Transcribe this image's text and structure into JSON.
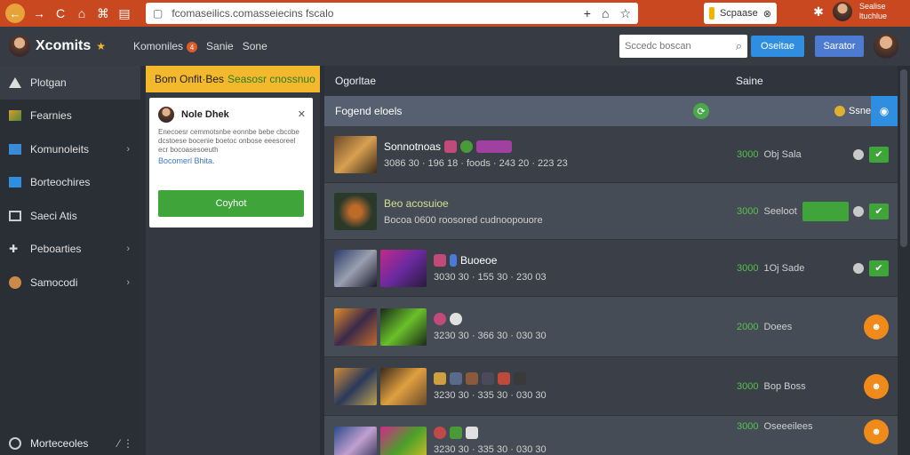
{
  "browser": {
    "url": "fcomaseilics.comasseiecins fscalo",
    "extension_label": "Scpaase",
    "user_line1": "Sealise",
    "user_line2": "ltuchlue",
    "icons": [
      "back-icon",
      "forward-icon",
      "reload-icon",
      "home-icon",
      "tabs-icon",
      "lock-icon",
      "add-icon",
      "bookmark-icon",
      "star-icon",
      "bug-icon"
    ]
  },
  "header": {
    "logo_text": "Xcomits",
    "nav": [
      {
        "label": "Komoniles",
        "badge": "4"
      },
      {
        "label": "Sanie"
      },
      {
        "label": "Sone"
      }
    ],
    "search_placeholder": "Sccedc boscan",
    "btn1": "Oseitae",
    "btn2": "Sarator"
  },
  "sidebar": {
    "items": [
      {
        "label": "Plotgan",
        "icon": "home-icon",
        "active": true
      },
      {
        "label": "Fearnies",
        "icon": "games-icon"
      },
      {
        "label": "Komunoleits",
        "icon": "community-icon",
        "chevron": true
      },
      {
        "label": "Borteochires",
        "icon": "trend-icon"
      },
      {
        "label": "Saeci Atis",
        "icon": "tv-icon"
      },
      {
        "label": "Peboarties",
        "icon": "puzzle-icon",
        "chevron": true
      },
      {
        "label": "Samocodi",
        "icon": "gear-icon",
        "chevron": true
      }
    ],
    "bottom": "Morteceoles"
  },
  "promo": {
    "head_text": "Bom Onfit·Bes",
    "head_highlight": "Seasosr cnossnuo",
    "card_title": "Nole Dhek",
    "card_body": "Enecoesr cemmotsnbe eonnbe bebe cbcobe dcstoese bocenie boetoc onbose eeesoreel ecr bocoasesoeuth",
    "card_link": "Bocomerl Bhita.",
    "card_button": "Coyhot"
  },
  "main": {
    "head_left": "Ogorltae",
    "head_right": "Saine",
    "filter_label": "Fogend eloels",
    "filter_right": "Ssne",
    "rows": [
      {
        "title": "Sonnotnoas",
        "meta": "3086 30 · 196 18 · foods · 243 20 · 223 23",
        "price": "3000",
        "price_label": "Obj Sala",
        "action": "check"
      },
      {
        "title": "Beo acosuioe",
        "meta": "Bocoa 0600 roosored cudnoopouore",
        "price": "3000",
        "price_label": "Seeloot",
        "action": "check-bar"
      },
      {
        "title": "Buoeoe",
        "meta": "3030 30 · 155 30 · 230 03",
        "price": "3000",
        "price_label": "1Oj Sade",
        "action": "check"
      },
      {
        "title": "",
        "meta": "3230 30 · 366 30 · 030 30",
        "price": "2000",
        "price_label": "Doees",
        "action": "orange"
      },
      {
        "title": "",
        "meta": "3230 30 · 335 30 · 030 30",
        "price": "3000",
        "price_label": "Bop Boss",
        "action": "orange"
      },
      {
        "title": "",
        "meta": "3230 30 · 335 30 · 030 30",
        "price": "3000",
        "price_label": "Oseeeilees",
        "action": "orange"
      }
    ]
  },
  "colors": {
    "chrome": "#c9481f",
    "accent_yellow": "#f3b82b",
    "green": "#3fa53b",
    "blue": "#2f8ee0",
    "orange": "#f08a1a"
  }
}
